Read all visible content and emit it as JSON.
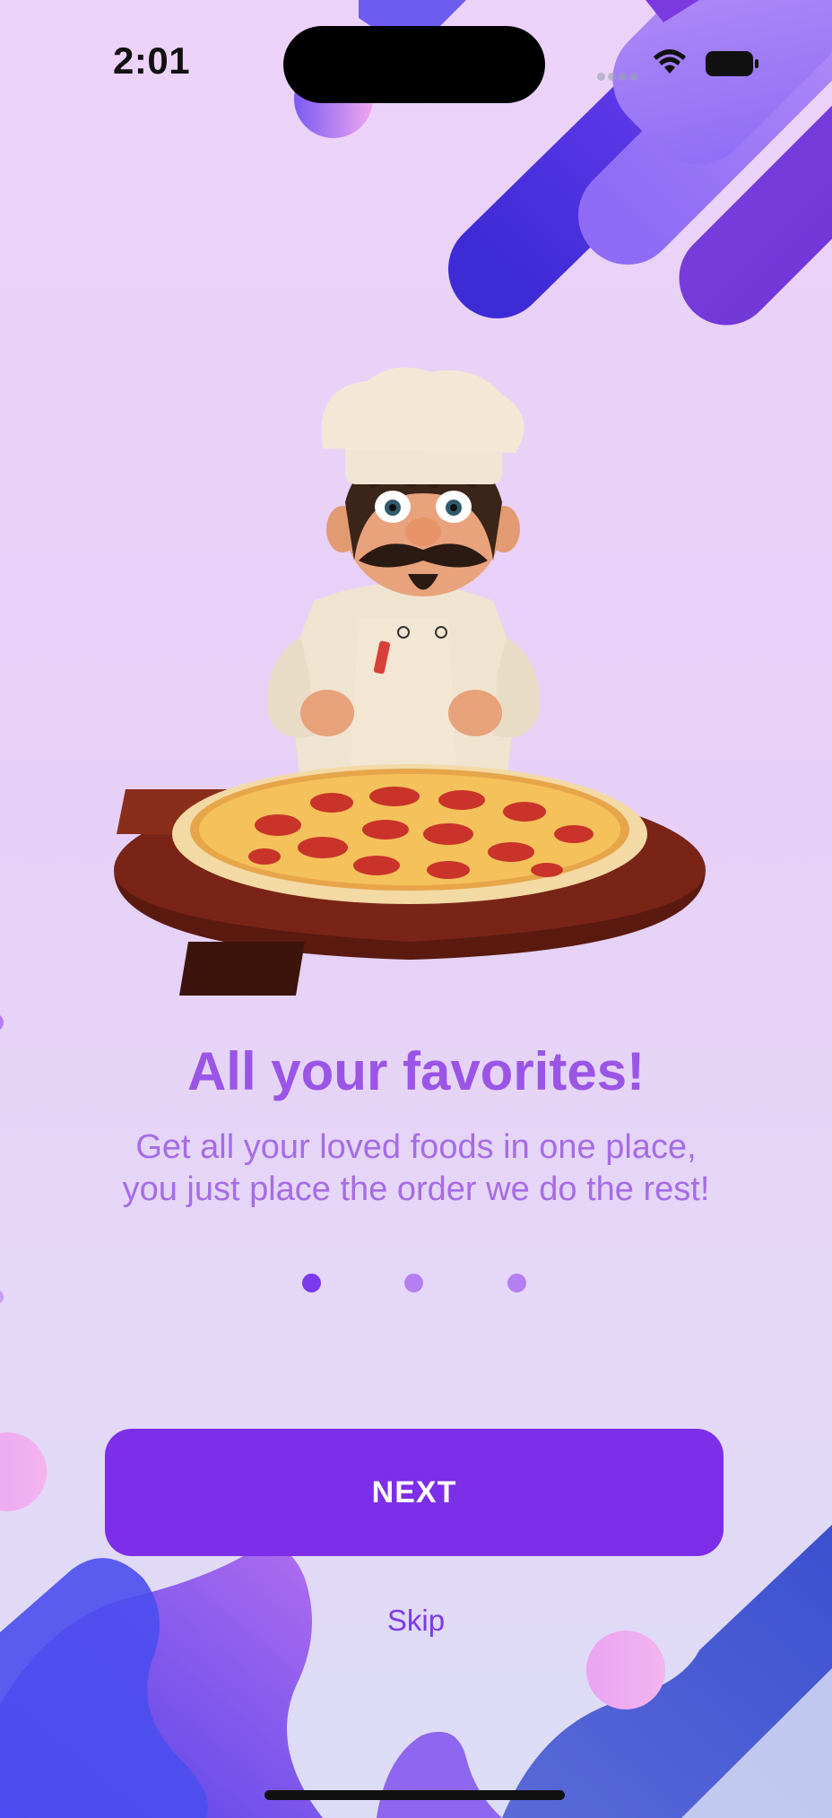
{
  "status_bar": {
    "time": "2:01",
    "icons": [
      "signal-dots-icon",
      "wifi-icon",
      "battery-icon"
    ]
  },
  "onboarding": {
    "illustration": "chef-with-pizza-illustration",
    "title": "All your favorites!",
    "subtitle_lines": [
      "Get all your loved foods in one place,",
      "you just place the order we do the rest!"
    ],
    "page_indicator": {
      "total": 3,
      "current": 1
    }
  },
  "actions": {
    "next_label": "NEXT",
    "skip_label": "Skip"
  },
  "colors": {
    "accent": "#7C2EE8",
    "title": "#9A55E6",
    "subtitle": "#A66CE6",
    "dot_inactive": "#B47FF0"
  }
}
